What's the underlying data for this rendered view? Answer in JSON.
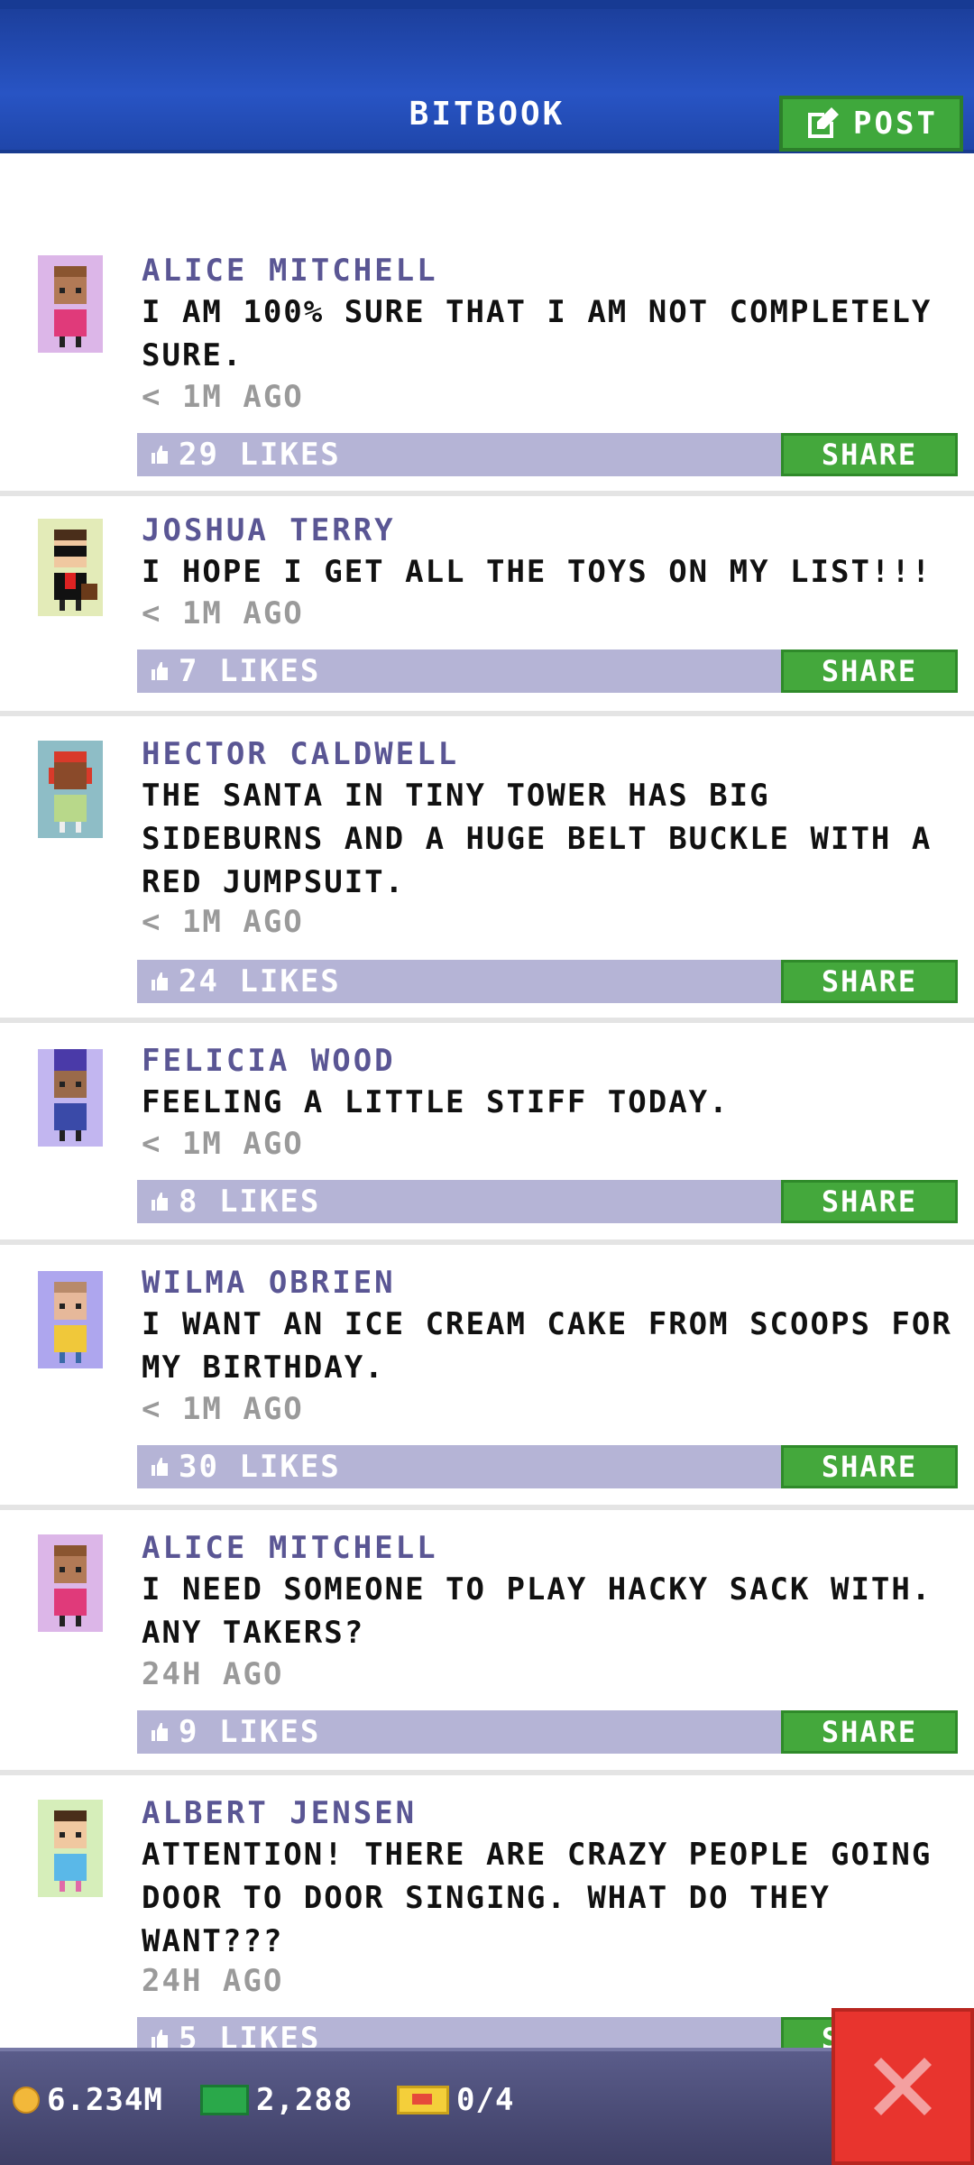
{
  "header": {
    "title": "BITBOOK",
    "post_label": "POST"
  },
  "posts": [
    {
      "author": "ALICE MITCHELL",
      "message": "I AM 100% SURE THAT I AM NOT COMPLETELY SURE.",
      "time": "< 1M AGO",
      "likes": "29 LIKES",
      "share": "SHARE",
      "avatar_bg": "#dcb6e8"
    },
    {
      "author": "JOSHUA TERRY",
      "message": "I HOPE I GET ALL THE TOYS ON MY LIST!!!",
      "time": "< 1M AGO",
      "likes": "7 LIKES",
      "share": "SHARE",
      "avatar_bg": "#e3ebb8"
    },
    {
      "author": "HECTOR CALDWELL",
      "message": "THE SANTA IN TINY TOWER HAS BIG SIDEBURNS AND A HUGE BELT BUCKLE WITH A RED JUMPSUIT.",
      "time": "< 1M AGO",
      "likes": "24 LIKES",
      "share": "SHARE",
      "avatar_bg": "#8ebdc6"
    },
    {
      "author": "FELICIA WOOD",
      "message": "FEELING A LITTLE STIFF TODAY.",
      "time": "< 1M AGO",
      "likes": "8 LIKES",
      "share": "SHARE",
      "avatar_bg": "#c2b6f0"
    },
    {
      "author": "WILMA OBRIEN",
      "message": "I WANT AN ICE CREAM CAKE FROM SCOOPS FOR MY BIRTHDAY.",
      "time": "< 1M AGO",
      "likes": "30 LIKES",
      "share": "SHARE",
      "avatar_bg": "#aea6ee"
    },
    {
      "author": "ALICE MITCHELL",
      "message": "I NEED SOMEONE TO PLAY HACKY SACK WITH. ANY TAKERS?",
      "time": "24H AGO",
      "likes": "9 LIKES",
      "share": "SHARE",
      "avatar_bg": "#dcb6e8"
    },
    {
      "author": "ALBERT JENSEN",
      "message": "ATTENTION! THERE ARE CRAZY PEOPLE GOING DOOR TO DOOR SINGING. WHAT DO THEY WANT???",
      "time": "24H AGO",
      "likes": "5 LIKES",
      "share": "SHARE",
      "avatar_bg": "#d6eeba"
    }
  ],
  "status": {
    "coins": "6.234M",
    "bux": "2,288",
    "tickets": "0/4"
  }
}
